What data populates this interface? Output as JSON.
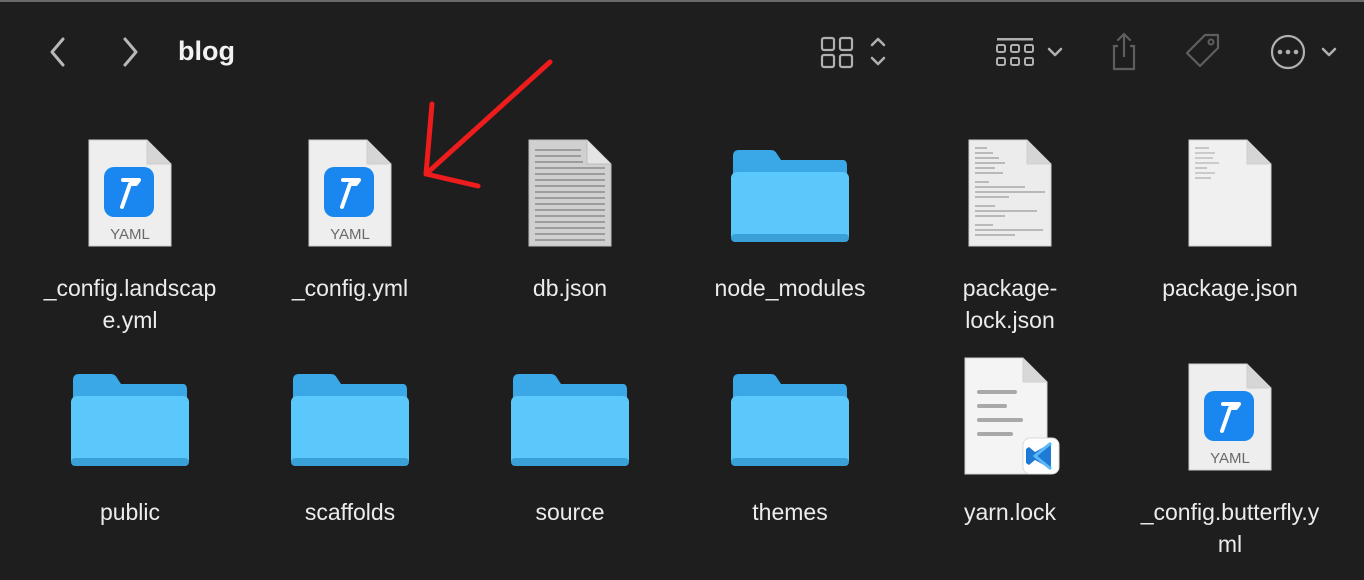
{
  "window": {
    "title": "blog",
    "accent_arrow_color": "#ee1c1c",
    "folder_color": "#5ac8fa"
  },
  "toolbar": {
    "back_icon": "chevron-left",
    "forward_icon": "chevron-right",
    "view_icon": "icon-grid-view",
    "group_icon": "group-by-grid",
    "share_icon": "share",
    "tag_icon": "tag",
    "more_icon": "ellipsis-circle"
  },
  "files": [
    {
      "name": "_config.landscape.yml",
      "kind": "yaml",
      "badge": "YAML"
    },
    {
      "name": "_config.yml",
      "kind": "yaml",
      "badge": "YAML"
    },
    {
      "name": "db.json",
      "kind": "text-dense"
    },
    {
      "name": "node_modules",
      "kind": "folder"
    },
    {
      "name": "package-lock.json",
      "kind": "text-doc"
    },
    {
      "name": "package.json",
      "kind": "text-doc-light"
    },
    {
      "name": "public",
      "kind": "folder"
    },
    {
      "name": "scaffolds",
      "kind": "folder"
    },
    {
      "name": "source",
      "kind": "folder"
    },
    {
      "name": "themes",
      "kind": "folder"
    },
    {
      "name": "yarn.lock",
      "kind": "vscode-doc"
    },
    {
      "name": "_config.butterfly.yml",
      "kind": "yaml",
      "badge": "YAML"
    }
  ],
  "labels": {
    "f0_line1": "_config.landscap",
    "f0_line2": "e.yml",
    "f4_line1": "package-",
    "f4_line2": "lock.json",
    "f11_line1": "_config.butterfly.y",
    "f11_line2": "ml"
  }
}
